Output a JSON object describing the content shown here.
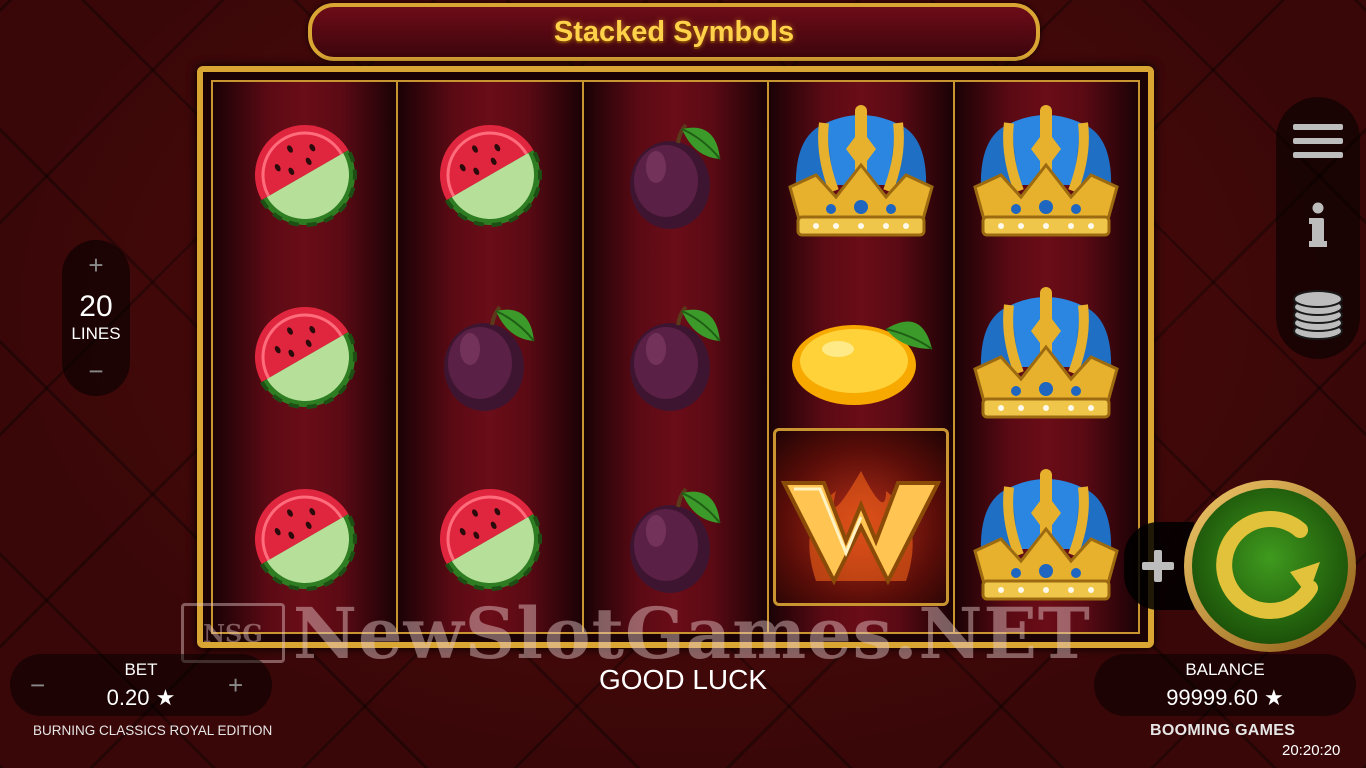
{
  "title_banner": {
    "text": "Stacked Symbols"
  },
  "reels": [
    [
      "watermelon",
      "watermelon",
      "watermelon"
    ],
    [
      "watermelon",
      "plum",
      "watermelon"
    ],
    [
      "plum",
      "plum",
      "plum"
    ],
    [
      "crown",
      "lemon",
      "wild"
    ],
    [
      "crown",
      "crown",
      "crown"
    ]
  ],
  "wild_symbol": {
    "letter": "W"
  },
  "lines": {
    "count": "20",
    "label": "LINES",
    "plus": "+",
    "minus": "−"
  },
  "side_menu": {
    "items": [
      "menu-icon",
      "info-icon",
      "coins-icon"
    ]
  },
  "bet": {
    "label": "BET",
    "value": "0.20 ★",
    "minus": "−",
    "plus": "+"
  },
  "game_name": "BURNING CLASSICS ROYAL EDITION",
  "status": "GOOD LUCK",
  "balance": {
    "label": "BALANCE",
    "value": "99999.60 ★"
  },
  "brand": "BOOMING GAMES",
  "clock": "20:20:20",
  "watermark": {
    "logo": "NSG",
    "text": "NewSlotGames.NET"
  },
  "colors": {
    "gold": "#d9a533",
    "title": "#ffd24a",
    "spin_green": "#2e7d16",
    "background": "#3a0708"
  }
}
